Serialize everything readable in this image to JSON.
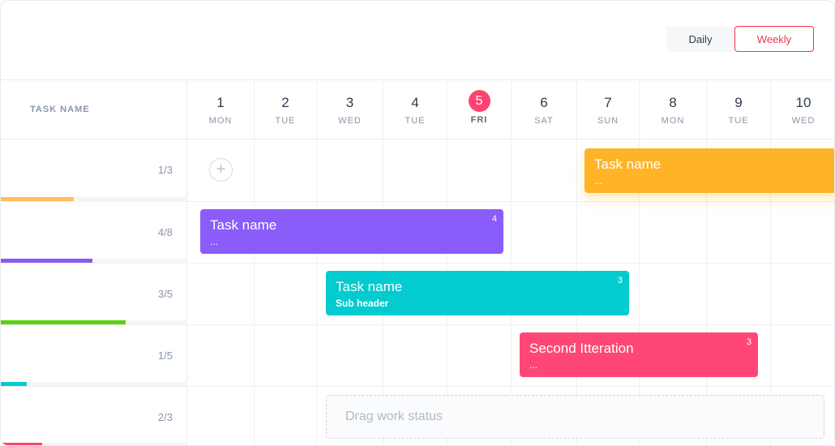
{
  "toolbar": {
    "daily_label": "Daily",
    "weekly_label": "Weekly",
    "active_view": "Weekly"
  },
  "header": {
    "task_column": "TASK NAME"
  },
  "days": [
    {
      "num": "1",
      "name": "MON"
    },
    {
      "num": "2",
      "name": "TUE"
    },
    {
      "num": "3",
      "name": "WED"
    },
    {
      "num": "4",
      "name": "TUE"
    },
    {
      "num": "5",
      "name": "FRI",
      "today": true
    },
    {
      "num": "6",
      "name": "SAT"
    },
    {
      "num": "7",
      "name": "SUN"
    },
    {
      "num": "8",
      "name": "MON"
    },
    {
      "num": "9",
      "name": "TUE"
    },
    {
      "num": "10",
      "name": "WED"
    }
  ],
  "rows": [
    {
      "count": "1/3",
      "progress": 0.39,
      "color": "#ffbf5b"
    },
    {
      "count": "4/8",
      "progress": 0.49,
      "color": "#8a5cf6"
    },
    {
      "count": "3/5",
      "progress": 0.67,
      "color": "#5ad10e"
    },
    {
      "count": "1/5",
      "progress": 0.14,
      "color": "#08c9d0"
    },
    {
      "count": "2/3",
      "progress": 0.22,
      "color": "#ff426f"
    }
  ],
  "tasks": [
    {
      "title": "Task name",
      "subtitle": "...",
      "badge": "",
      "color": "#ffb428"
    },
    {
      "title": "Task name",
      "subtitle": "...",
      "badge": "4",
      "color": "#8a5cfa"
    },
    {
      "title": "Task name",
      "subtitle": "Sub header",
      "badge": "3",
      "color": "#03cbd0"
    },
    {
      "title": "Second Itteration",
      "subtitle": "...",
      "badge": "3",
      "color": "#ff4777"
    }
  ],
  "drop_zone": {
    "label": "Drag work status"
  },
  "icons": {
    "add": "plus-icon"
  }
}
